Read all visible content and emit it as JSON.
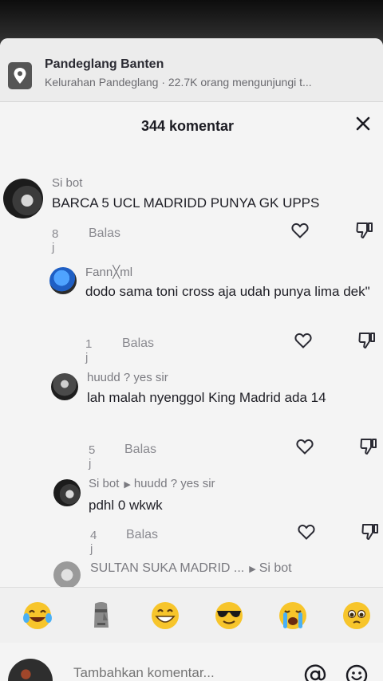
{
  "location": {
    "title": "Pandeglang Banten",
    "subtitle": "Kelurahan Pandeglang · 22.7K orang mengunjungi t..."
  },
  "header": {
    "title": "344 komentar"
  },
  "comments": [
    {
      "user": "Si bot",
      "text": "BARCA 5 UCL MADRIDD PUNYA GK UPPS",
      "time": "8 j",
      "reply": "Balas"
    },
    {
      "user": "Fann╳ml",
      "text": "dodo sama toni cross aja udah punya lima dek\"",
      "time": "1 j",
      "reply": "Balas"
    },
    {
      "user": "huudd ? yes sir",
      "text": "lah malah nyenggol King Madrid ada 14",
      "time": "5 j",
      "reply": "Balas"
    },
    {
      "user": "Si bot",
      "reply_to": "huudd ? yes sir",
      "text": "pdhl 0 wkwk",
      "time": "4 j",
      "reply": "Balas"
    },
    {
      "user": "SULTAN SUKA MADRID ...",
      "reply_to": "Si bot"
    }
  ],
  "emojis": [
    {
      "icon": "laughing-crying-emoji"
    },
    {
      "icon": "moai-emoji"
    },
    {
      "icon": "grinning-emoji"
    },
    {
      "icon": "sunglasses-emoji"
    },
    {
      "icon": "loudly-crying-emoji"
    },
    {
      "icon": "pleading-emoji"
    }
  ],
  "input": {
    "placeholder": "Tambahkan komentar..."
  },
  "colors": {
    "sheet": "#f4f4f4",
    "text": "#1e1e25",
    "muted": "#8a8a90",
    "accent_blue": "#1f6bd6"
  }
}
